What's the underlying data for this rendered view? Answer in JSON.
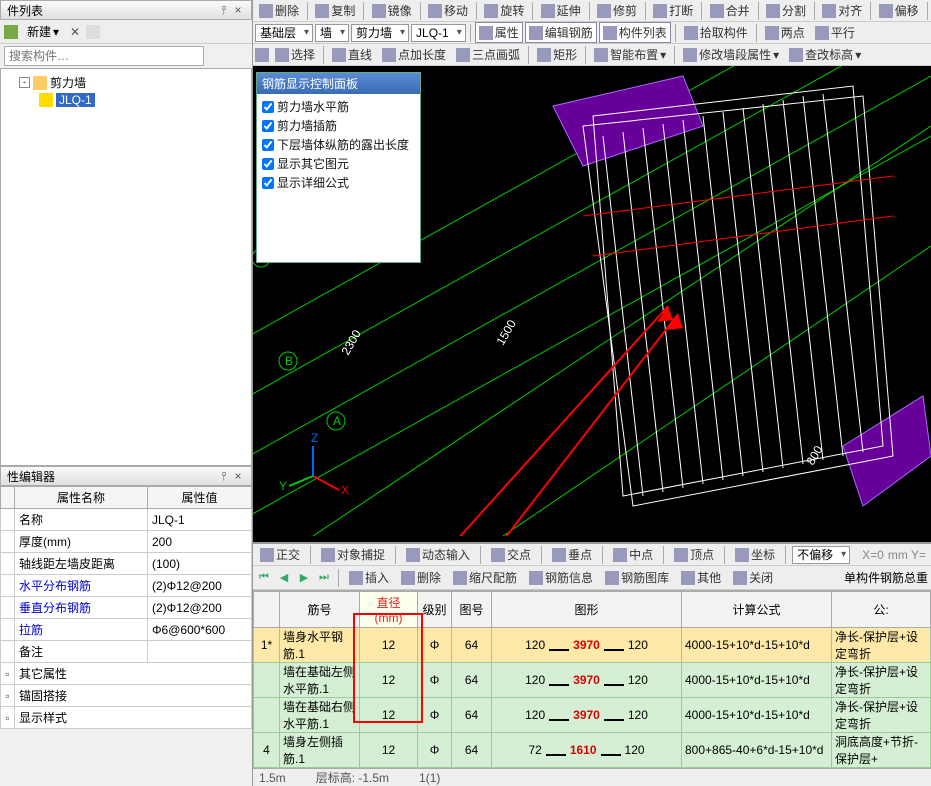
{
  "left": {
    "list_title": "件列表",
    "new_btn": "新建",
    "search_placeholder": "搜索构件…",
    "tree_root": "剪力墙",
    "tree_child": "JLQ-1"
  },
  "prop": {
    "title": "性编辑器",
    "col_name": "属性名称",
    "col_value": "属性值",
    "rows": [
      {
        "name": "名称",
        "value": "JLQ-1",
        "sel": true
      },
      {
        "name": "厚度(mm)",
        "value": "200"
      },
      {
        "name": "轴线距左墙皮距离",
        "value": "(100)"
      },
      {
        "name": "水平分布钢筋",
        "value": "(2)Φ12@200",
        "link": true
      },
      {
        "name": "垂直分布钢筋",
        "value": "(2)Φ12@200",
        "link": true
      },
      {
        "name": "拉筋",
        "value": "Φ6@600*600",
        "link": true
      },
      {
        "name": "备注",
        "value": ""
      }
    ],
    "groups": [
      "其它属性",
      "锚固搭接",
      "显示样式"
    ]
  },
  "toolbars": {
    "row1": [
      "删除",
      "复制",
      "镜像",
      "移动",
      "旋转",
      "延伸",
      "修剪",
      "打断",
      "合并",
      "分割",
      "对齐",
      "偏移"
    ],
    "row2_dropdowns": [
      "基础层",
      "墙",
      "剪力墙",
      "JLQ-1"
    ],
    "row2_btns": [
      "属性",
      "编辑钢筋",
      "构件列表",
      "拾取构件",
      "两点",
      "平行"
    ],
    "row3": [
      "选择",
      "直线",
      "点加长度",
      "三点画弧",
      "矩形",
      "智能布置",
      "修改墙段属性",
      "查改标高"
    ]
  },
  "rebar_panel": {
    "title": "钢筋显示控制面板",
    "items": [
      "剪力墙水平筋",
      "剪力墙插筋",
      "下层墙体纵筋的露出长度",
      "显示其它图元",
      "显示详细公式"
    ]
  },
  "viewport_labels": {
    "A": "A",
    "B": "B",
    "C": "C",
    "d1": "2300",
    "d2": "1500",
    "d3": "800"
  },
  "snapbar": {
    "items": [
      "正交",
      "对象捕捉",
      "动态输入",
      "交点",
      "垂点",
      "中点",
      "顶点",
      "坐标"
    ],
    "offset": "不偏移",
    "xy": "mm  Y="
  },
  "grid_tb": {
    "items": [
      "插入",
      "删除",
      "缩尺配筋",
      "钢筋信息",
      "钢筋图库",
      "其他",
      "关闭"
    ],
    "right": "单构件钢筋总重"
  },
  "table": {
    "headers": [
      "",
      "筋号",
      "直径(mm)",
      "级别",
      "图号",
      "图形",
      "计算公式",
      "公:"
    ],
    "rows": [
      {
        "idx": "1*",
        "name": "墙身水平钢筋.1",
        "dia": "12",
        "lvl": "Φ",
        "fig": "64",
        "s1": "120",
        "mid": "3970",
        "s2": "120",
        "formula": "4000-15+10*d-15+10*d",
        "note": "净长-保护层+设定弯折"
      },
      {
        "idx": "",
        "name": "墙在基础左侧水平筋.1",
        "dia": "12",
        "lvl": "Φ",
        "fig": "64",
        "s1": "120",
        "mid": "3970",
        "s2": "120",
        "formula": "4000-15+10*d-15+10*d",
        "note": "净长-保护层+设定弯折"
      },
      {
        "idx": "",
        "name": "墙在基础右侧水平筋.1",
        "dia": "12",
        "lvl": "Φ",
        "fig": "64",
        "s1": "120",
        "mid": "3970",
        "s2": "120",
        "formula": "4000-15+10*d-15+10*d",
        "note": "净长-保护层+设定弯折"
      },
      {
        "idx": "4",
        "name": "墙身左侧插筋.1",
        "dia": "12",
        "lvl": "Φ",
        "fig": "64",
        "s1": "72",
        "mid": "1610",
        "s2": "120",
        "formula": "800+865-40+6*d-15+10*d",
        "note": "洞底高度+节折-保护层+"
      }
    ]
  },
  "status": {
    "a": "1.5m",
    "b": "层标高: -1.5m",
    "c": "1(1)"
  },
  "chart_data": {
    "type": "table",
    "note": "3D rebar scene, not a chart"
  }
}
